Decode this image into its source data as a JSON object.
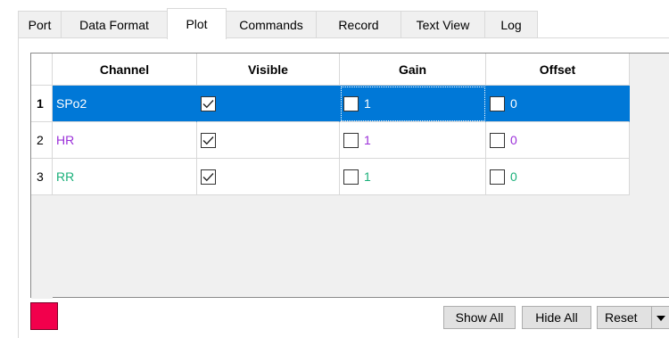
{
  "tabs": [
    {
      "label": "Port",
      "width": 0
    },
    {
      "label": "Data Format"
    },
    {
      "label": "Plot",
      "active": true
    },
    {
      "label": "Commands"
    },
    {
      "label": "Record"
    },
    {
      "label": "Text View"
    },
    {
      "label": "Log"
    }
  ],
  "table": {
    "columns": [
      "Channel",
      "Visible",
      "Gain",
      "Offset"
    ],
    "rows": [
      {
        "num": "1",
        "channel": "SPo2",
        "visible": true,
        "gain_checked": false,
        "gain": "1",
        "offset_checked": false,
        "offset": "0",
        "color": "#ffffff",
        "selected": true
      },
      {
        "num": "2",
        "channel": "HR",
        "visible": true,
        "gain_checked": false,
        "gain": "1",
        "offset_checked": false,
        "offset": "0",
        "color": "#9b30d9",
        "selected": false
      },
      {
        "num": "3",
        "channel": "RR",
        "visible": true,
        "gain_checked": false,
        "gain": "1",
        "offset_checked": false,
        "offset": "0",
        "color": "#1ab07a",
        "selected": false
      }
    ]
  },
  "toolbar": {
    "show_all_label": "Show All",
    "hide_all_label": "Hide All",
    "reset_label": "Reset"
  },
  "colors": {
    "swatch": "#f2004c",
    "selection": "#0078d7"
  },
  "icons": {
    "checkbox": "checkbox-icon",
    "dropdown": "chevron-down-icon"
  }
}
